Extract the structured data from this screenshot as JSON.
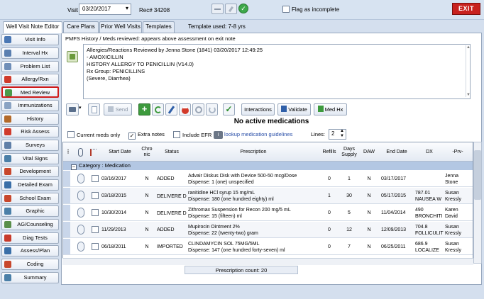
{
  "topbar": {
    "visit_date_label": "Visit date:",
    "visit_date_value": "03/20/2017",
    "rec_label": "Rec# 34208",
    "flag_label": "Flag as incomplete",
    "exit_label": "EXIT"
  },
  "tabs": [
    {
      "label": "Well Visit Note Editor",
      "active": true
    },
    {
      "label": "Care Plans",
      "active": false
    },
    {
      "label": "Prior Well Visits",
      "active": false
    },
    {
      "label": "Templates",
      "active": false
    }
  ],
  "template_used": "Template used:  7-8 yrs",
  "sidebar": {
    "items": [
      {
        "label": "Visit Info",
        "icon": "info-icon",
        "color": "#4a77b4"
      },
      {
        "label": "Interval Hx",
        "icon": "clock-icon",
        "color": "#5a7fb0"
      },
      {
        "label": "Problem List",
        "icon": "list-icon",
        "color": "#6f8eb8"
      },
      {
        "label": "Allergy/Rxn",
        "icon": "allergy-icon",
        "color": "#d03a2b"
      },
      {
        "label": "Med Review",
        "icon": "pill-icon",
        "color": "#4a9a4a",
        "selected": true
      },
      {
        "label": "Immunizations",
        "icon": "syringe-icon",
        "color": "#8aa3c3"
      },
      {
        "label": "History",
        "icon": "history-icon",
        "color": "#b36a2a"
      },
      {
        "label": "Risk Assess",
        "icon": "no-icon",
        "color": "#d03a2b"
      },
      {
        "label": "Surveys",
        "icon": "survey-icon",
        "color": "#5f7fa8"
      },
      {
        "label": "Vital Signs",
        "icon": "vitals-icon",
        "color": "#4a7fa8"
      },
      {
        "label": "Development",
        "icon": "development-icon",
        "color": "#c8472c"
      },
      {
        "label": "Detailed Exam",
        "icon": "exam-icon",
        "color": "#3a6fa8"
      },
      {
        "label": "School Exam",
        "icon": "school-icon",
        "color": "#c8472c"
      },
      {
        "label": "Graphic",
        "icon": "graph-icon",
        "color": "#4a7fa8"
      },
      {
        "label": "AG/Counseling",
        "icon": "counseling-icon",
        "color": "#5a8f4a"
      },
      {
        "label": "Diag Tests",
        "icon": "diag-icon",
        "color": "#c83a2a"
      },
      {
        "label": "Assess/Plan",
        "icon": "plan-icon",
        "color": "#3a6fa8"
      },
      {
        "label": "Coding",
        "icon": "coding-icon",
        "color": "#c8472c"
      },
      {
        "label": "Summary",
        "icon": "summary-icon",
        "color": "#4a7fa8"
      }
    ]
  },
  "pmfs_title": "PMFS History / Meds reviewed: appears above assessment on exit note",
  "allergy_text": "Allergies/Reactions Reviewed by Jenna Stone (1841) 03/20/2017 12:49:25\n- AMOXICILLIN\nHISTORY ALLERGY TO PENICILLIN (V14.0)\nRx Group: PENICILLINS\n(Severe, Diarrhea)",
  "toolbar": {
    "send_label": "Send",
    "interactions_label": "Interactions",
    "validate_label": "Validate",
    "medhx_label": "Med Hx"
  },
  "no_active_label": "No active medications",
  "options": {
    "current_meds_label": "Current meds only",
    "extra_notes_label": "Extra notes",
    "extra_notes_checked": true,
    "include_efr_label": "Include EFR",
    "lookup_label": "lookup medication guidelines",
    "lines_label": "Lines:",
    "lines_value": "2"
  },
  "grid": {
    "headers": {
      "start": "Start Date",
      "chronic": "Chro nic",
      "status": "Status",
      "prescription": "Prescription",
      "refills": "Refills",
      "days": "Days Supply",
      "daw": "DAW",
      "end": "End Date",
      "dx": "DX",
      "prv": "-Prv-"
    },
    "category": "Category : Medication",
    "rows": [
      {
        "start": "03/16/2017",
        "chronic": "N",
        "status": "ADDED",
        "rx1": "Advair Diskus Disk with Device 500-50 mcg/Dose",
        "rx2": "Dispense: 1 (one) unspecified",
        "refills": "0",
        "days": "1",
        "daw": "N",
        "end": "03/17/2017",
        "dx1": "",
        "dx2": "",
        "prv1": "Jenna",
        "prv2": "Stone"
      },
      {
        "start": "03/18/2015",
        "chronic": "N",
        "status": "DELIVERE D",
        "rx1": "ranitidine HCl syrup 15 mg/mL",
        "rx2": "Dispense: 180 (one hundred eighty) ml",
        "refills": "1",
        "days": "30",
        "daw": "N",
        "end": "05/17/2015",
        "dx1": "787.01",
        "dx2": "NAUSEA W",
        "prv1": "Susan",
        "prv2": "Kressly"
      },
      {
        "start": "10/30/2014",
        "chronic": "N",
        "status": "DELIVERE D",
        "rx1": "Zithromax Suspension for Recon 200 mg/5 mL",
        "rx2": "Dispense: 15 (fifteen) ml",
        "refills": "0",
        "days": "5",
        "daw": "N",
        "end": "11/04/2014",
        "dx1": "490",
        "dx2": "BRONCHITI",
        "prv1": "Karen",
        "prv2": "David"
      },
      {
        "start": "11/29/2013",
        "chronic": "N",
        "status": "ADDED",
        "rx1": "Mupirocin Ointment 2%",
        "rx2": "Dispense: 22 (twenty-two) gram",
        "refills": "0",
        "days": "12",
        "daw": "N",
        "end": "12/09/2013",
        "dx1": "704.8",
        "dx2": "FOLLICULIT",
        "prv1": "Susan",
        "prv2": "Kressly"
      },
      {
        "start": "06/18/2011",
        "chronic": "N",
        "status": "IMPORTED",
        "rx1": "CLINDAMYCIN  SOL 75MG/5ML",
        "rx2": "Dispense: 147 (one hundred forty-seven) ml",
        "refills": "0",
        "days": "7",
        "daw": "N",
        "end": "06/25/2011",
        "dx1": "686.9",
        "dx2": "LOCALIZE",
        "prv1": "Susan",
        "prv2": "Kressly"
      }
    ],
    "count_label": "Prescription count: 20"
  }
}
